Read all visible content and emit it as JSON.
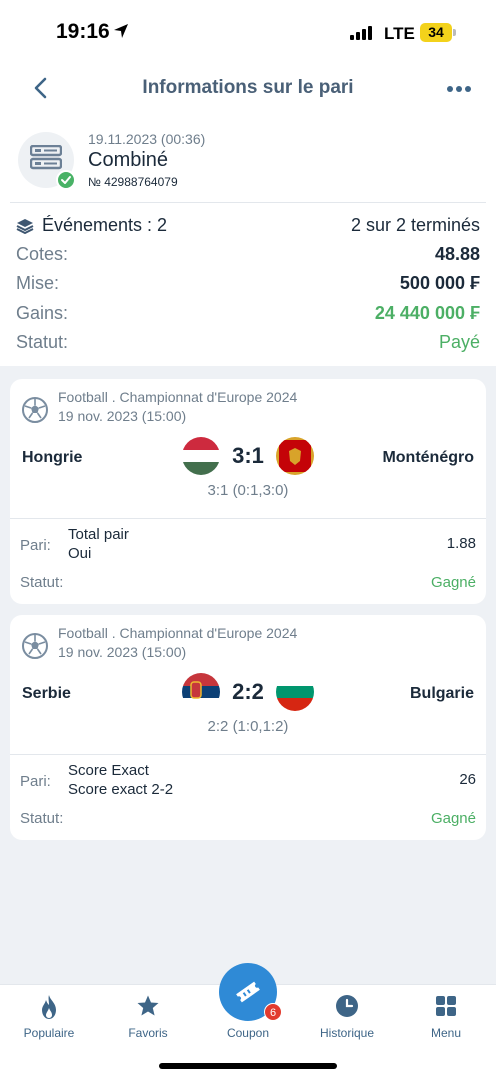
{
  "status_bar": {
    "time": "19:16",
    "network": "LTE",
    "battery": "34"
  },
  "header": {
    "title": "Informations sur le pari"
  },
  "bet": {
    "date": "19.11.2023 (00:36)",
    "type": "Combiné",
    "number": "№ 42988764079",
    "events_label": "Événements : 2",
    "events_done": "2 sur 2 terminés",
    "rows": [
      {
        "label": "Cotes:",
        "value": "48.88"
      },
      {
        "label": "Mise:",
        "value": "500 000 ₣"
      },
      {
        "label": "Gains:",
        "value": "24 440 000 ₣"
      },
      {
        "label": "Statut:",
        "value": "Payé"
      }
    ]
  },
  "events": [
    {
      "league": "Football . Championnat d'Europe 2024",
      "date": "19 nov. 2023 (15:00)",
      "home": "Hongrie",
      "away": "Monténégro",
      "score": "3:1",
      "score_detail": "3:1 (0:1,3:0)",
      "pari_label": "Pari:",
      "market": "Total pair",
      "outcome": "Oui",
      "odds": "1.88",
      "statut_label": "Statut:",
      "statut": "Gagné"
    },
    {
      "league": "Football . Championnat d'Europe 2024",
      "date": "19 nov. 2023 (15:00)",
      "home": "Serbie",
      "away": "Bulgarie",
      "score": "2:2",
      "score_detail": "2:2 (1:0,1:2)",
      "pari_label": "Pari:",
      "market": "Score Exact",
      "outcome": "Score exact 2-2",
      "odds": "26",
      "statut_label": "Statut:",
      "statut": "Gagné"
    }
  ],
  "nav": {
    "items": [
      {
        "label": "Populaire",
        "icon": "flame-icon"
      },
      {
        "label": "Favoris",
        "icon": "star-icon"
      },
      {
        "label": "Coupon",
        "icon": "ticket-icon"
      },
      {
        "label": "Historique",
        "icon": "clock-icon"
      },
      {
        "label": "Menu",
        "icon": "grid-icon"
      }
    ],
    "coupon_badge": "6"
  },
  "colors": {
    "accent": "#2f8ad6",
    "win": "#4caf65",
    "badge": "#e23b2e"
  }
}
